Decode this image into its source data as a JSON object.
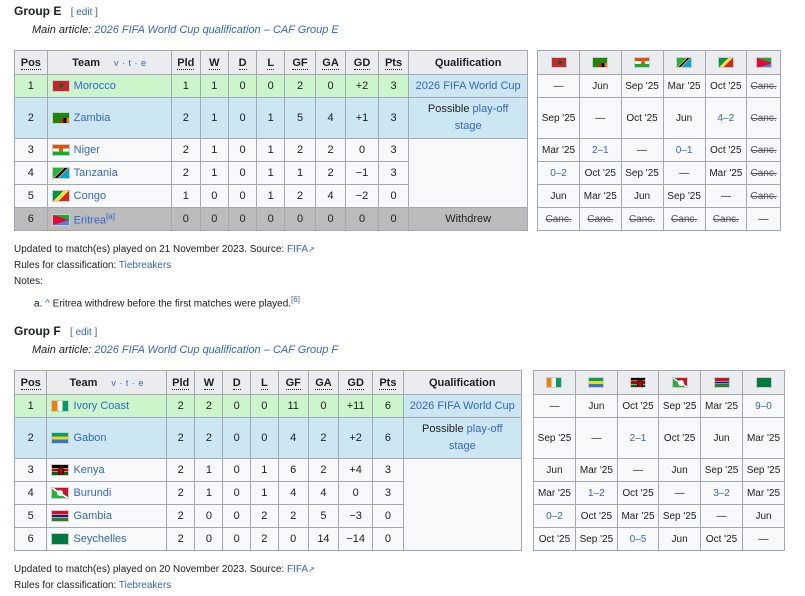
{
  "groupE": {
    "title": "Group E",
    "edit_label": "edit",
    "main_article_prefix": "Main article:",
    "main_article_link": "2026 FIFA World Cup qualification – CAF Group E",
    "headers": [
      "Pos",
      "Team",
      "Pld",
      "W",
      "D",
      "L",
      "GF",
      "GA",
      "GD",
      "Pts",
      "Qualification"
    ],
    "vte": "v · t · e",
    "rows": [
      {
        "pos": "1",
        "team": "Morocco",
        "pld": "1",
        "w": "1",
        "d": "0",
        "l": "0",
        "gf": "2",
        "ga": "0",
        "gd": "+2",
        "pts": "3",
        "res": [
          "—",
          "Jun",
          "Sep '25",
          "Mar '25",
          "Oct '25",
          "Canc."
        ]
      },
      {
        "pos": "2",
        "team": "Zambia",
        "pld": "2",
        "w": "1",
        "d": "0",
        "l": "1",
        "gf": "5",
        "ga": "4",
        "gd": "+1",
        "pts": "3",
        "res": [
          "Sep '25",
          "—",
          "Oct '25",
          "Jun",
          "4–2",
          "Canc."
        ]
      },
      {
        "pos": "3",
        "team": "Niger",
        "pld": "2",
        "w": "1",
        "d": "0",
        "l": "1",
        "gf": "2",
        "ga": "2",
        "gd": "0",
        "pts": "3",
        "res": [
          "Mar '25",
          "2–1",
          "—",
          "0–1",
          "Oct '25",
          "Canc."
        ]
      },
      {
        "pos": "4",
        "team": "Tanzania",
        "pld": "2",
        "w": "1",
        "d": "0",
        "l": "1",
        "gf": "1",
        "ga": "2",
        "gd": "−1",
        "pts": "3",
        "res": [
          "0–2",
          "Oct '25",
          "Sep '25",
          "—",
          "Mar '25",
          "Canc."
        ]
      },
      {
        "pos": "5",
        "team": "Congo",
        "pld": "1",
        "w": "0",
        "d": "0",
        "l": "1",
        "gf": "2",
        "ga": "4",
        "gd": "−2",
        "pts": "0",
        "res": [
          "Jun",
          "Mar '25",
          "Jun",
          "Sep '25",
          "—",
          "Canc."
        ]
      },
      {
        "pos": "6",
        "team": "Eritrea",
        "pld": "0",
        "w": "0",
        "d": "0",
        "l": "0",
        "gf": "0",
        "ga": "0",
        "gd": "0",
        "pts": "0",
        "res": [
          "Canc.",
          "Canc.",
          "Canc.",
          "Canc.",
          "Canc.",
          "—"
        ]
      }
    ],
    "eritrea_note_ref": "[a]",
    "qual_1": "2026 FIFA World Cup",
    "qual_2_prefix": "Possible ",
    "qual_2_link": "play-off",
    "qual_2_suffix": "stage",
    "withdrew": "Withdrew",
    "updated_prefix": "Updated to match(es) played on 21 November 2023. Source: ",
    "source_link": "FIFA",
    "rules_prefix": "Rules for classification: ",
    "rules_link": "Tiebreakers",
    "notes_label": "Notes:",
    "note_a_marker": "a.",
    "note_a_caret": "^",
    "note_a_text": " Eritrea withdrew before the first matches were played.",
    "note_a_ref": "[6]"
  },
  "groupF": {
    "title": "Group F",
    "edit_label": "edit",
    "main_article_prefix": "Main article:",
    "main_article_link": "2026 FIFA World Cup qualification – CAF Group F",
    "headers": [
      "Pos",
      "Team",
      "Pld",
      "W",
      "D",
      "L",
      "GF",
      "GA",
      "GD",
      "Pts",
      "Qualification"
    ],
    "vte": "v · t · e",
    "rows": [
      {
        "pos": "1",
        "team": "Ivory Coast",
        "pld": "2",
        "w": "2",
        "d": "0",
        "l": "0",
        "gf": "11",
        "ga": "0",
        "gd": "+11",
        "pts": "6",
        "res": [
          "—",
          "Jun",
          "Oct '25",
          "Sep '25",
          "Mar '25",
          "9–0"
        ]
      },
      {
        "pos": "2",
        "team": "Gabon",
        "pld": "2",
        "w": "2",
        "d": "0",
        "l": "0",
        "gf": "4",
        "ga": "2",
        "gd": "+2",
        "pts": "6",
        "res": [
          "Sep '25",
          "—",
          "2–1",
          "Oct '25",
          "Jun",
          "Mar '25"
        ]
      },
      {
        "pos": "3",
        "team": "Kenya",
        "pld": "2",
        "w": "1",
        "d": "0",
        "l": "1",
        "gf": "6",
        "ga": "2",
        "gd": "+4",
        "pts": "3",
        "res": [
          "Jun",
          "Mar '25",
          "—",
          "Jun",
          "Sep '25",
          "Sep '25"
        ]
      },
      {
        "pos": "4",
        "team": "Burundi",
        "pld": "2",
        "w": "1",
        "d": "0",
        "l": "1",
        "gf": "4",
        "ga": "4",
        "gd": "0",
        "pts": "3",
        "res": [
          "Mar '25",
          "1–2",
          "Oct '25",
          "—",
          "3–2",
          "Mar '25"
        ]
      },
      {
        "pos": "5",
        "team": "Gambia",
        "pld": "2",
        "w": "0",
        "d": "0",
        "l": "2",
        "gf": "2",
        "ga": "5",
        "gd": "−3",
        "pts": "0",
        "res": [
          "0–2",
          "Oct '25",
          "Mar '25",
          "Sep '25",
          "—",
          "Jun"
        ]
      },
      {
        "pos": "6",
        "team": "Seychelles",
        "pld": "2",
        "w": "0",
        "d": "0",
        "l": "2",
        "gf": "0",
        "ga": "14",
        "gd": "−14",
        "pts": "0",
        "res": [
          "Oct '25",
          "Sep '25",
          "0–5",
          "Jun",
          "Oct '25",
          "—"
        ]
      }
    ],
    "qual_1": "2026 FIFA World Cup",
    "qual_2_prefix": "Possible ",
    "qual_2_link": "play-off",
    "qual_2_suffix": "stage",
    "updated_prefix": "Updated to match(es) played on 20 November 2023. Source: ",
    "source_link": "FIFA",
    "rules_prefix": "Rules for classification: ",
    "rules_link": "Tiebreakers"
  },
  "colors": {
    "qualified": "#ccf5cc",
    "playoff": "#cce6f2",
    "withdrawn": "#bbbbbb",
    "link": "#3366cc"
  },
  "icons": {
    "external_link": "external-link-icon",
    "flags_e": [
      "morocco-flag-icon",
      "zambia-flag-icon",
      "niger-flag-icon",
      "tanzania-flag-icon",
      "congo-flag-icon",
      "eritrea-flag-icon"
    ],
    "flags_f": [
      "ivory-coast-flag-icon",
      "gabon-flag-icon",
      "kenya-flag-icon",
      "burundi-flag-icon",
      "gambia-flag-icon",
      "seychelles-flag-icon"
    ]
  }
}
